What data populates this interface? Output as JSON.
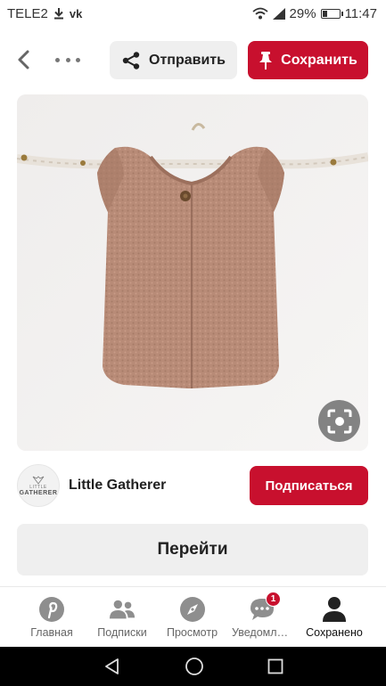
{
  "status_bar": {
    "carrier": "TELE2",
    "battery_percent": "29%",
    "battery_level": 0.29,
    "time": "11:47",
    "icons": [
      "download-icon",
      "vk-icon",
      "wifi-icon",
      "signal-icon",
      "battery-icon"
    ],
    "vk_label": "vk"
  },
  "header": {
    "send_label": "Отправить",
    "save_label": "Сохранить"
  },
  "pin": {
    "image_subject": "knitted-vest-photo"
  },
  "creator": {
    "avatar_small": "LITTLE",
    "avatar_big": "GATHERER",
    "name": "Little Gatherer",
    "follow_label": "Подписаться"
  },
  "visit": {
    "label": "Перейти"
  },
  "bottom_nav": {
    "items": [
      {
        "label": "Главная",
        "icon": "pinterest-icon"
      },
      {
        "label": "Подписки",
        "icon": "people-icon"
      },
      {
        "label": "Просмотр",
        "icon": "compass-icon"
      },
      {
        "label": "Уведомления",
        "icon": "chat-icon",
        "badge": "1"
      },
      {
        "label": "Сохранено",
        "icon": "profile-icon"
      }
    ],
    "active_index": 4
  },
  "colors": {
    "brand_red": "#c8102e",
    "button_gray": "#efefef"
  }
}
